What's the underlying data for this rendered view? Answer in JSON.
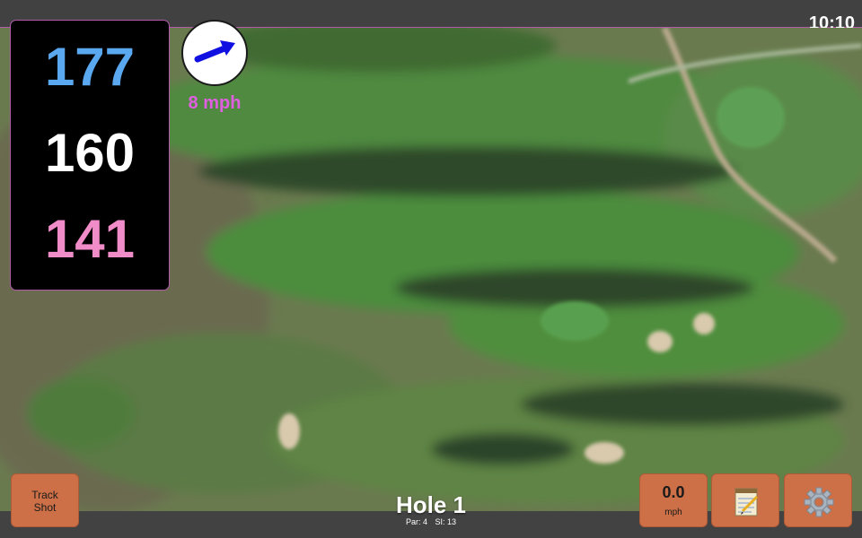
{
  "status": {
    "time": "10:10"
  },
  "distances": {
    "back": "177",
    "middle": "160",
    "front": "141"
  },
  "colors": {
    "back": "#5aa8f0",
    "middle": "#ffffff",
    "front": "#f08cc8",
    "wind_arrow": "#1010e0",
    "wind_text": "#e05fe0",
    "button": "#cd7047"
  },
  "wind": {
    "speed_label": "8 mph",
    "direction_icon": "arrow-icon"
  },
  "buttons": {
    "track_shot": "Track\nShot",
    "speed_value": "0.0",
    "speed_unit": "mph",
    "notes_icon": "notepad-icon",
    "settings_icon": "gear-icon"
  },
  "hole": {
    "title": "Hole 1",
    "par": "Par: 4",
    "si": "SI: 13"
  }
}
